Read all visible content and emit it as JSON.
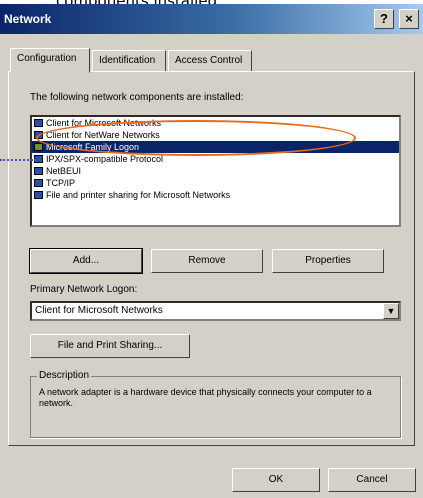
{
  "header_caption": "components installed.",
  "window": {
    "title": "Network",
    "help_button": "?",
    "close_button": "×"
  },
  "tabs": [
    {
      "label": "Configuration"
    },
    {
      "label": "Identification"
    },
    {
      "label": "Access Control"
    }
  ],
  "components_label": "The following network components are installed:",
  "components": [
    {
      "label": "Client for Microsoft Networks"
    },
    {
      "label": "Client for NetWare Networks"
    },
    {
      "label": "Microsoft Family Logon"
    },
    {
      "label": "IPX/SPX-compatible Protocol"
    },
    {
      "label": "NetBEUI"
    },
    {
      "label": "TCP/IP"
    },
    {
      "label": "File and printer sharing for Microsoft Networks"
    }
  ],
  "selected_index": 2,
  "buttons": {
    "add": "Add...",
    "remove": "Remove",
    "properties": "Properties",
    "file_print_sharing": "File and Print Sharing...",
    "ok": "OK",
    "cancel": "Cancel"
  },
  "primary_logon": {
    "label": "Primary Network Logon:",
    "value": "Client for Microsoft Networks"
  },
  "description": {
    "legend": "Description",
    "text": "A network adapter is a hardware device that physically connects your computer to a network."
  },
  "colors": {
    "annotation_circle": "#e86a1a",
    "annotation_dots": "#4a4ad6",
    "selection": "#0a246a"
  }
}
